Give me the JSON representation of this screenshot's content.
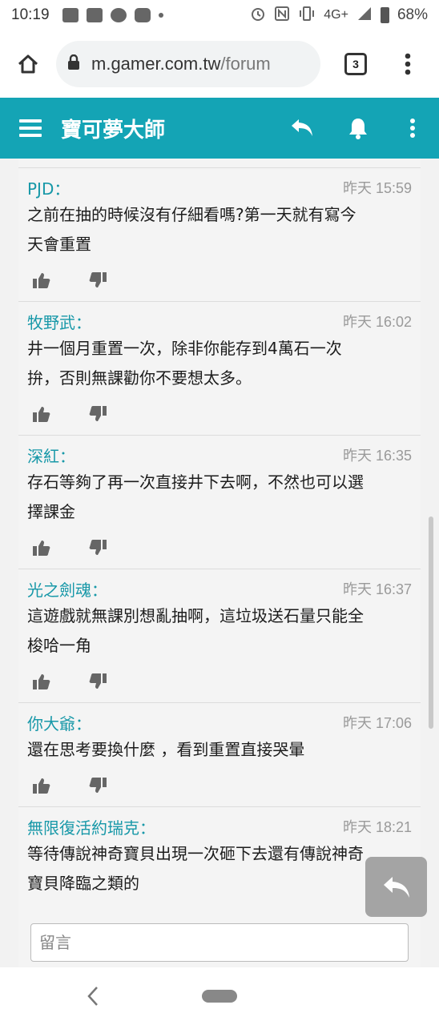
{
  "status_bar": {
    "time": "10:19",
    "network": "4G+",
    "battery": "68%"
  },
  "browser": {
    "url_main": "m.gamer.com.tw",
    "url_rest": "/forum",
    "tab_count": "3"
  },
  "header": {
    "title": "寶可夢大師"
  },
  "comments": [
    {
      "author": "PJD：",
      "time": "昨天 15:59",
      "lines": [
        "之前在抽的時候沒有仔細看嗎?第一天就有寫今",
        "天會重置"
      ]
    },
    {
      "author": "牧野武：",
      "time": "昨天 16:02",
      "lines": [
        "井一個月重置一次，除非你能存到4萬石一次",
        "拚，否則無課勸你不要想太多。"
      ]
    },
    {
      "author": "深紅：",
      "time": "昨天 16:35",
      "lines": [
        "存石等夠了再一次直接井下去啊，不然也可以選",
        "擇課金"
      ]
    },
    {
      "author": "光之劍魂：",
      "time": "昨天 16:37",
      "lines": [
        "這遊戲就無課別想亂抽啊，這垃圾送石量只能全",
        "梭哈一角"
      ]
    },
    {
      "author": "你大爺：",
      "time": "昨天 17:06",
      "lines": [
        "還在思考要換什麼 ，看到重置直接哭暈"
      ]
    },
    {
      "author": "無限復活約瑞克：",
      "time": "昨天 18:21",
      "lines": [
        "等待傳說神奇寶貝出現一次砸下去還有傳說神奇",
        "寶貝降臨之類的"
      ]
    }
  ],
  "reply_box": {
    "placeholder": "留言"
  },
  "colors": {
    "header_bg": "#14a4b5",
    "author": "#1798a8",
    "time": "#9a9a9a"
  },
  "icons": {
    "like": "thumbs-up-icon",
    "dislike": "thumbs-down-icon",
    "reply": "reply-arrow-icon",
    "notify": "bell-icon"
  }
}
